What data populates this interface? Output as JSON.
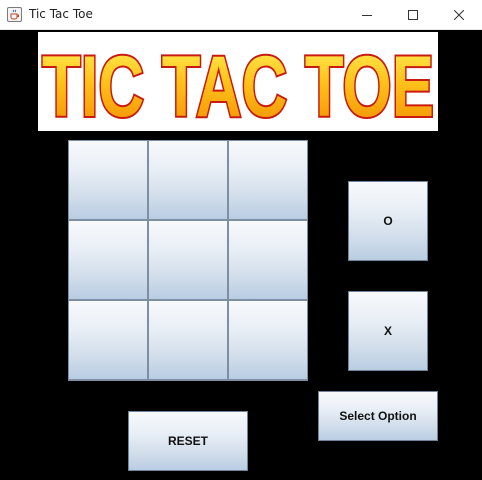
{
  "window": {
    "title": "Tic Tac Toe",
    "icon": "java-cup-icon",
    "controls": [
      "minimize-icon",
      "maximize-icon",
      "close-icon"
    ]
  },
  "logo": {
    "text": "TIC TAC TOE",
    "colors": {
      "fill_top": "#fff35a",
      "fill_bottom": "#f08a00",
      "outline": "#c81a10"
    }
  },
  "board": {
    "cells": [
      "",
      "",
      "",
      "",
      "",
      "",
      "",
      "",
      ""
    ]
  },
  "buttons": {
    "o_label": "O",
    "x_label": "X",
    "select_label": "Select Option",
    "reset_label": "RESET"
  },
  "colors": {
    "background": "#000000",
    "button_top": "#f7f9fc",
    "button_bottom": "#b9cde2",
    "grid_line": "#7d8fa0"
  }
}
